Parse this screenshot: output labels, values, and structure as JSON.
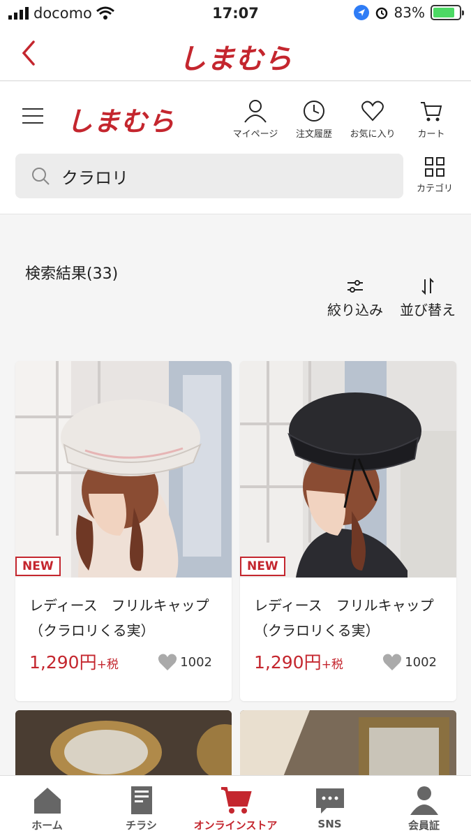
{
  "status_bar": {
    "carrier": "docomo",
    "time": "17:07",
    "battery": "83%",
    "battery_level": 0.83
  },
  "nav": {
    "title_logo": "しまむら"
  },
  "header": {
    "logo": "しまむら",
    "icons": [
      {
        "label": "マイページ",
        "icon": "person-icon"
      },
      {
        "label": "注文履歴",
        "icon": "history-icon"
      },
      {
        "label": "お気に入り",
        "icon": "heart-icon"
      },
      {
        "label": "カート",
        "icon": "cart-icon"
      }
    ]
  },
  "search": {
    "query": "クラロリ"
  },
  "category": {
    "label": "カテゴリ"
  },
  "results": {
    "title": "検索結果(33)"
  },
  "tools": {
    "filter_label": "絞り込み",
    "sort_label": "並び替え"
  },
  "products": [
    {
      "badge": "NEW",
      "name": "レディース　フリルキャップ（クラロリくる実）",
      "price": "1,290円",
      "tax": "+税",
      "likes": "1002",
      "hat_color": "#ece8e4"
    },
    {
      "badge": "NEW",
      "name": "レディース　フリルキャップ（クラロリくる実）",
      "price": "1,290円",
      "tax": "+税",
      "likes": "1002",
      "hat_color": "#2a2a2e"
    }
  ],
  "tabbar": {
    "items": [
      {
        "label": "ホーム",
        "icon": "home-icon"
      },
      {
        "label": "チラシ",
        "icon": "flyer-icon"
      },
      {
        "label": "オンラインストア",
        "icon": "cart-icon",
        "active": true
      },
      {
        "label": "SNS",
        "icon": "chat-icon"
      },
      {
        "label": "会員証",
        "icon": "member-icon"
      }
    ]
  },
  "colors": {
    "brand": "#c4262e",
    "text": "#222222",
    "bg": "#f5f5f5"
  }
}
